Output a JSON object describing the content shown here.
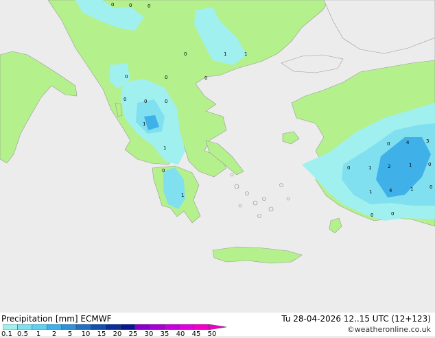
{
  "legend": {
    "title": "Precipitation [mm]",
    "model": "ECMWF",
    "ticks": [
      "0.1",
      "0.5",
      "1",
      "2",
      "5",
      "10",
      "15",
      "20",
      "25",
      "30",
      "35",
      "40",
      "45",
      "50"
    ],
    "colors": [
      "#a0f0f0",
      "#80e0f0",
      "#60d0f0",
      "#40b0e8",
      "#3090d8",
      "#2070c8",
      "#1050b0",
      "#0a2f98",
      "#081890",
      "#8800cc",
      "#a800d8",
      "#c800e0",
      "#e000e0",
      "#f000c8"
    ]
  },
  "datetime": "Tu 28-04-2026 12..15 UTC (12+123)",
  "credit": "©weatheronline.co.uk",
  "map_labels": {
    "l1": "0",
    "l2": "0",
    "l3": "0",
    "l4": "0",
    "l5": "1",
    "l6": "1",
    "l7": "0",
    "l8": "0",
    "l9": "0",
    "l10": "0",
    "l11": "0",
    "l12": "0",
    "l13": "1",
    "l14": "0",
    "l15": "1",
    "l16": "0",
    "l17": "4",
    "l18": "3",
    "l19": "0",
    "l20": "1",
    "l21": "2",
    "l22": "1",
    "l23": "0",
    "l24": "1",
    "l25": "4",
    "l26": "1",
    "l27": "0",
    "l28": "0",
    "l29": "1",
    "l30": "0"
  },
  "colors": {
    "land": "#b4f08c",
    "sea": "#ececec",
    "light_precip": "#a0f0f0",
    "moderate_precip": "#80e0f0",
    "heavy_precip": "#40b0e8"
  }
}
